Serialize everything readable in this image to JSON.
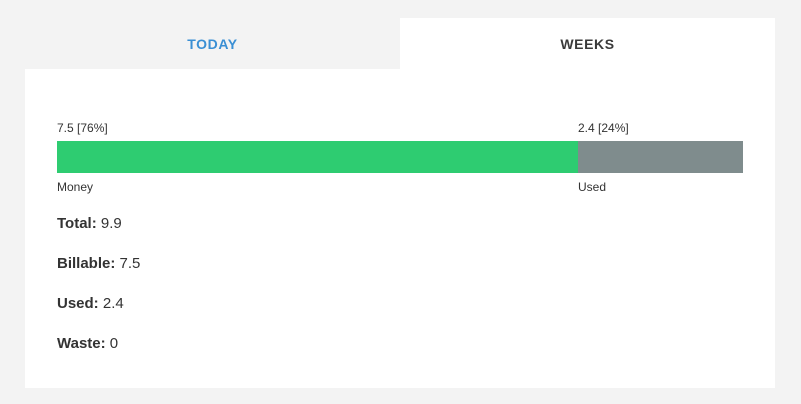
{
  "tabs": [
    {
      "label": "TODAY",
      "active": false
    },
    {
      "label": "WEEKS",
      "active": true
    }
  ],
  "bar": {
    "segments": [
      {
        "name": "Money",
        "value": 7.5,
        "top_label": "7.5 [76%]",
        "fraction": 0.76,
        "color": "#2ecc71"
      },
      {
        "name": "Used",
        "value": 2.4,
        "top_label": "2.4 [24%]",
        "fraction": 0.24,
        "color": "#7f8c8d"
      }
    ]
  },
  "stats": [
    {
      "label": "Total:",
      "value": "9.9"
    },
    {
      "label": "Billable:",
      "value": "7.5"
    },
    {
      "label": "Used:",
      "value": "2.4"
    },
    {
      "label": "Waste:",
      "value": "0"
    }
  ],
  "colors": {
    "accent": "#3a8fd4",
    "money": "#2ecc71",
    "used": "#7f8c8d"
  }
}
